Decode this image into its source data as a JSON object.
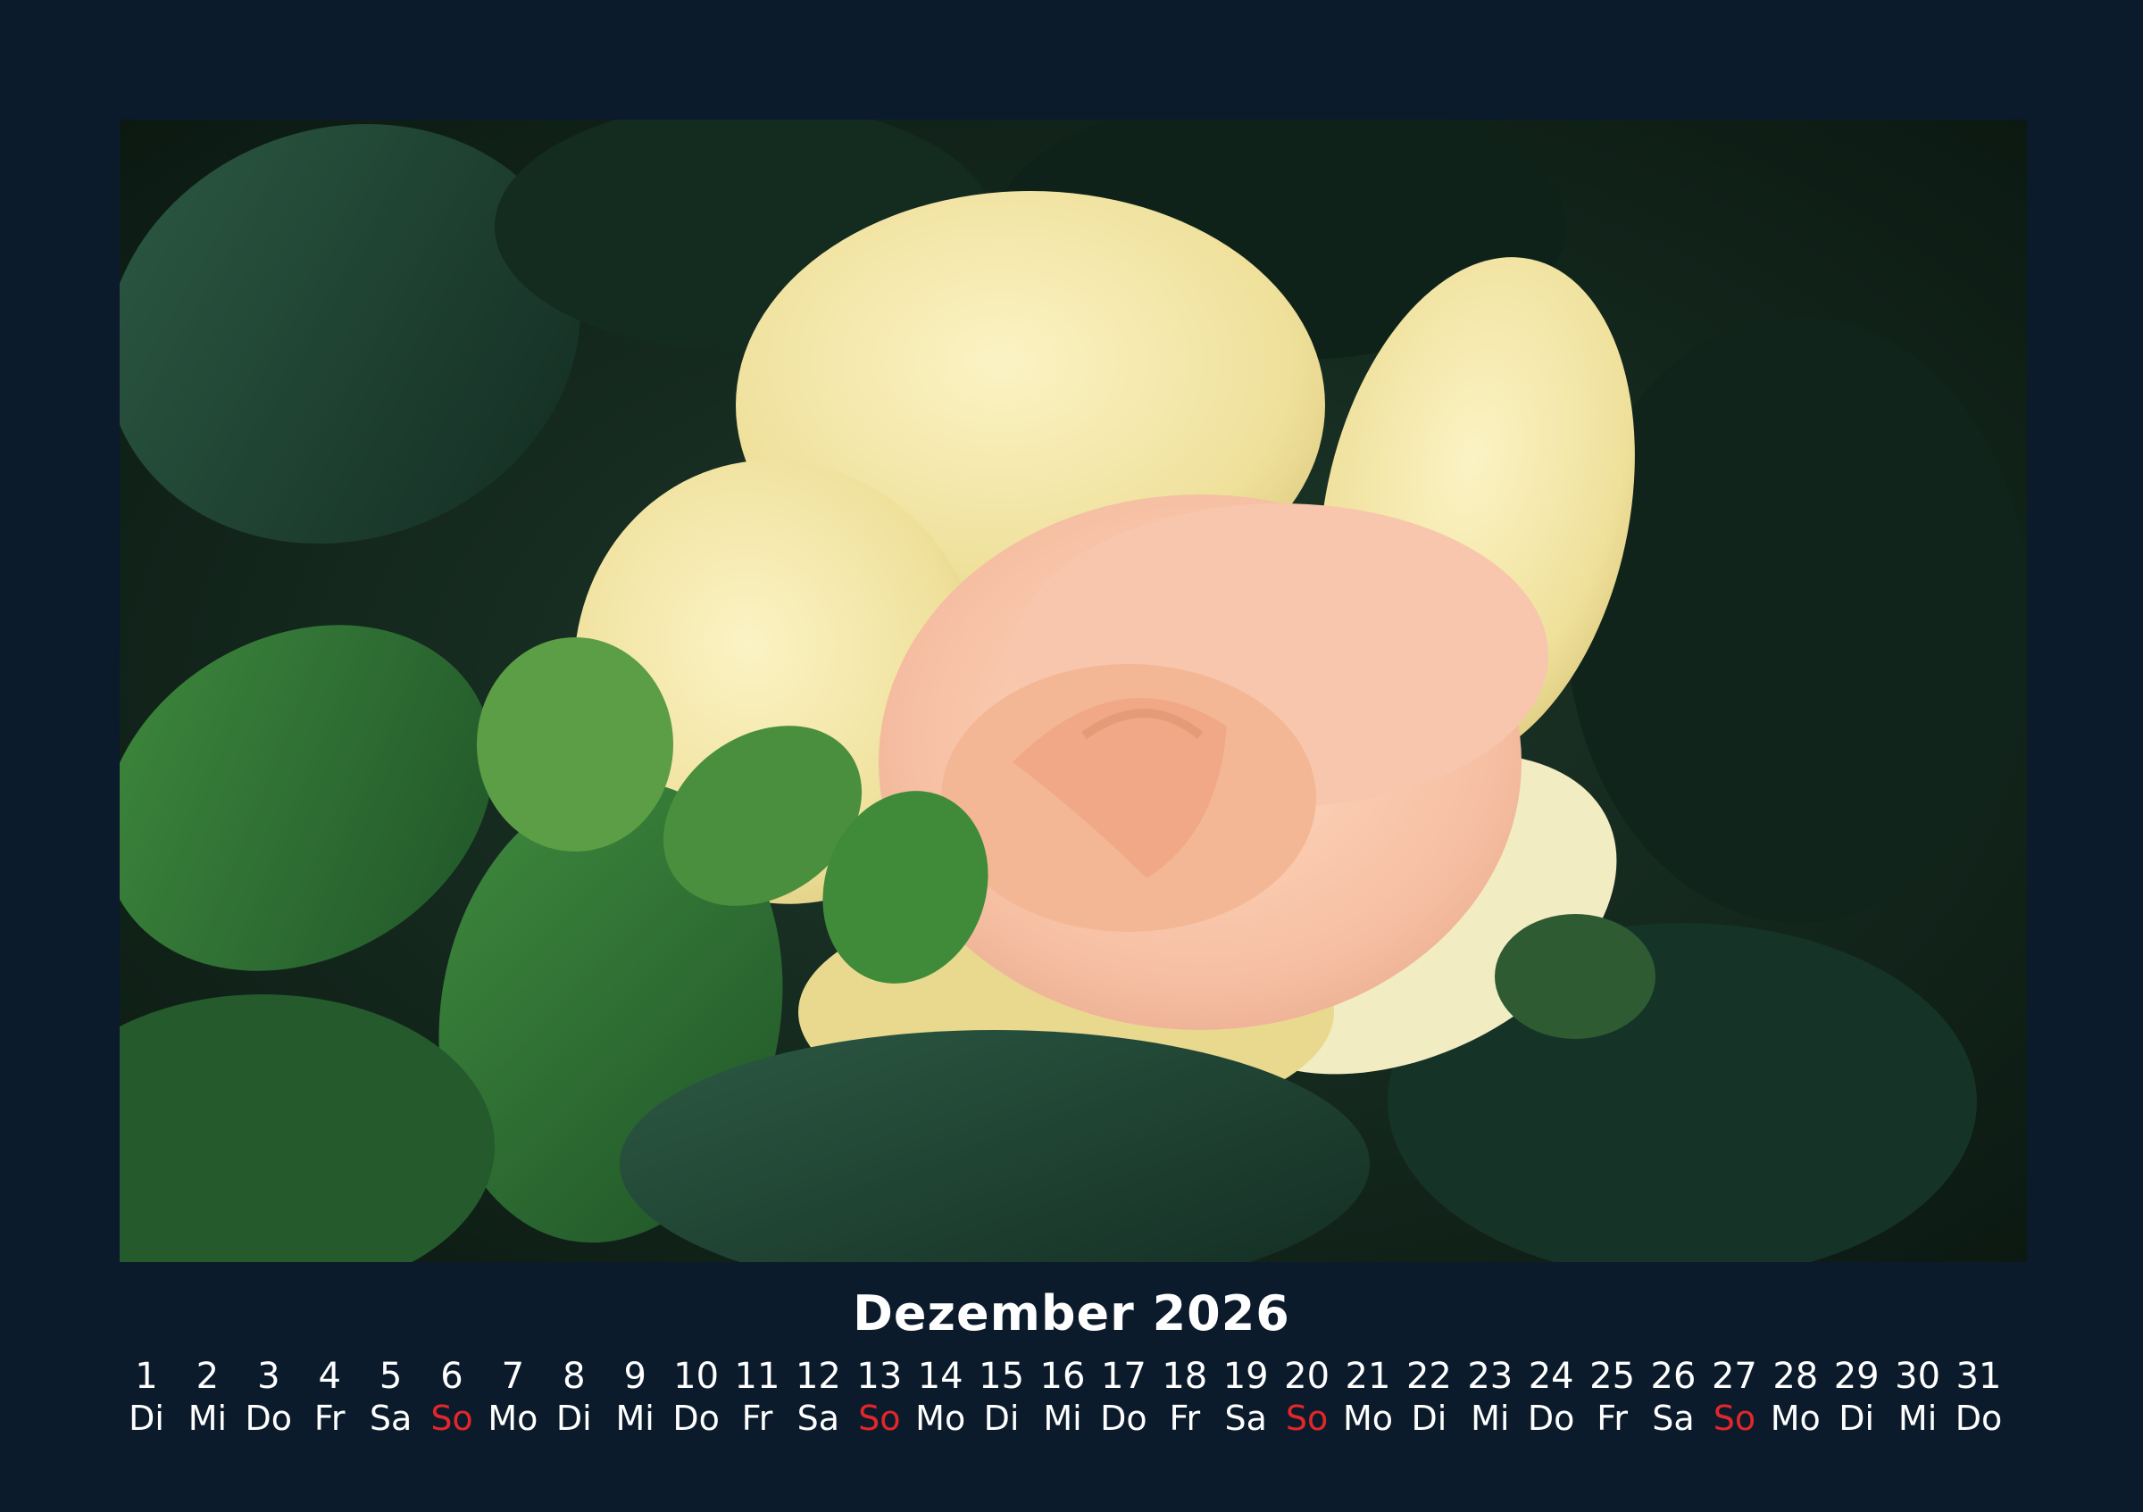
{
  "calendar": {
    "month_title": "Dezember 2026",
    "sunday_color": "#e3262a",
    "text_color": "#ffffff",
    "background_color": "#0b1b2b",
    "days": [
      {
        "num": "1",
        "wd": "Di",
        "sunday": false
      },
      {
        "num": "2",
        "wd": "Mi",
        "sunday": false
      },
      {
        "num": "3",
        "wd": "Do",
        "sunday": false
      },
      {
        "num": "4",
        "wd": "Fr",
        "sunday": false
      },
      {
        "num": "5",
        "wd": "Sa",
        "sunday": false
      },
      {
        "num": "6",
        "wd": "So",
        "sunday": true
      },
      {
        "num": "7",
        "wd": "Mo",
        "sunday": false
      },
      {
        "num": "8",
        "wd": "Di",
        "sunday": false
      },
      {
        "num": "9",
        "wd": "Mi",
        "sunday": false
      },
      {
        "num": "10",
        "wd": "Do",
        "sunday": false
      },
      {
        "num": "11",
        "wd": "Fr",
        "sunday": false
      },
      {
        "num": "12",
        "wd": "Sa",
        "sunday": false
      },
      {
        "num": "13",
        "wd": "So",
        "sunday": true
      },
      {
        "num": "14",
        "wd": "Mo",
        "sunday": false
      },
      {
        "num": "15",
        "wd": "Di",
        "sunday": false
      },
      {
        "num": "16",
        "wd": "Mi",
        "sunday": false
      },
      {
        "num": "17",
        "wd": "Do",
        "sunday": false
      },
      {
        "num": "18",
        "wd": "Fr",
        "sunday": false
      },
      {
        "num": "19",
        "wd": "Sa",
        "sunday": false
      },
      {
        "num": "20",
        "wd": "So",
        "sunday": true
      },
      {
        "num": "21",
        "wd": "Mo",
        "sunday": false
      },
      {
        "num": "22",
        "wd": "Di",
        "sunday": false
      },
      {
        "num": "23",
        "wd": "Mi",
        "sunday": false
      },
      {
        "num": "24",
        "wd": "Do",
        "sunday": false
      },
      {
        "num": "25",
        "wd": "Fr",
        "sunday": false
      },
      {
        "num": "26",
        "wd": "Sa",
        "sunday": false
      },
      {
        "num": "27",
        "wd": "So",
        "sunday": true
      },
      {
        "num": "28",
        "wd": "Mo",
        "sunday": false
      },
      {
        "num": "29",
        "wd": "Di",
        "sunday": false
      },
      {
        "num": "30",
        "wd": "Mi",
        "sunday": false
      },
      {
        "num": "31",
        "wd": "Do",
        "sunday": false
      }
    ]
  }
}
